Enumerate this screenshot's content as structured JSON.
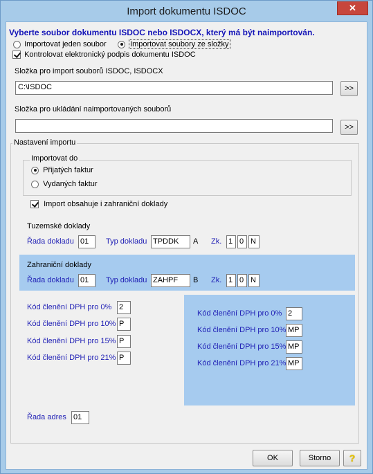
{
  "window": {
    "title": "Import dokumentu ISDOC",
    "close_glyph": "✕"
  },
  "header": {
    "instruction": "Vyberte soubor dokumentu ISDOC nebo ISDOCX, který má být naimportován."
  },
  "mode": {
    "single_label": "Importovat jeden soubor",
    "folder_label": "Importovat soubory ze složky",
    "selected": "folder",
    "signature_label": "Kontrolovat elektronický podpis dokumentu ISDOC",
    "signature_checked": true
  },
  "import_folder": {
    "label": "Složka pro import souborů ISDOC, ISDOCX",
    "value": "C:\\ISDOC",
    "browse_label": ">>"
  },
  "save_folder": {
    "label": "Složka pro ukládání naimportovaných souborů",
    "value": "",
    "browse_label": ">>"
  },
  "settings": {
    "group_label": "Nastavení importu",
    "import_to": {
      "group_label": "Importovat do",
      "received_label": "Přijatých faktur",
      "issued_label": "Vydaných faktur",
      "selected": "received"
    },
    "foreign_label": "Import obsahuje i zahraniční doklady",
    "foreign_checked": true,
    "domestic": {
      "title": "Tuzemské doklady",
      "series_label": "Řada dokladu",
      "series_value": "01",
      "type_label": "Typ dokladu",
      "type_value": "TPDDK",
      "type_suffix": "A",
      "zk_label": "Zk.",
      "zk1": "1",
      "zk2": "0",
      "zk3": "N"
    },
    "foreign": {
      "title": "Zahraniční doklady",
      "series_label": "Řada dokladu",
      "series_value": "01",
      "type_label": "Typ dokladu",
      "type_value": "ZAHPF",
      "type_suffix": "B",
      "zk_label": "Zk.",
      "zk1": "1",
      "zk2": "0",
      "zk3": "N"
    },
    "vat_domestic": [
      {
        "label": "Kód členění DPH pro 0%",
        "value": "2"
      },
      {
        "label": "Kód členění DPH pro 10%",
        "value": "P"
      },
      {
        "label": "Kód členění DPH pro 15%",
        "value": "P"
      },
      {
        "label": "Kód členění DPH pro 21%",
        "value": "P"
      }
    ],
    "vat_foreign": [
      {
        "label": "Kód členění DPH pro 0%",
        "value": "2"
      },
      {
        "label": "Kód členění DPH pro 10%",
        "value": "MP"
      },
      {
        "label": "Kód členění DPH pro 15%",
        "value": "MP"
      },
      {
        "label": "Kód členění DPH pro 21%",
        "value": "MP"
      }
    ],
    "address_series": {
      "label": "Řada adres",
      "value": "01"
    }
  },
  "footer": {
    "ok_label": "OK",
    "cancel_label": "Storno",
    "help_glyph": "?"
  },
  "colors": {
    "accent_text": "#1f1fb5",
    "foreign_panel": "#a6cbef",
    "help_icon": "#e8c500"
  }
}
